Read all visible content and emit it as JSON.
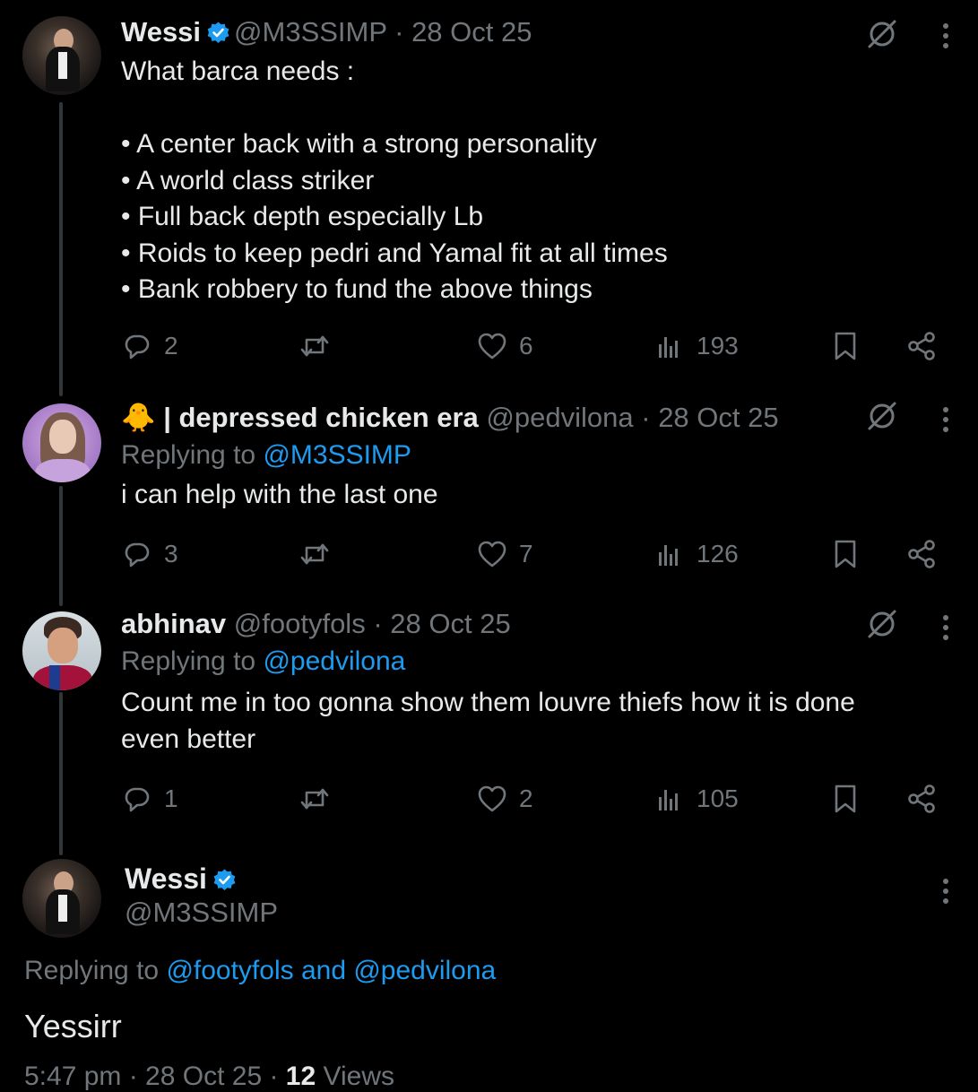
{
  "colors": {
    "background": "#000000",
    "text": "#e7e9ea",
    "muted": "#71767b",
    "link": "#1d9bf0",
    "verified": "#1d9bf0"
  },
  "tweets": [
    {
      "name": "Wessi",
      "handle": "@M3SSIMP",
      "date": "28 Oct 25",
      "text": "What barca needs :\n\n• A center back with a strong personality\n• A world class striker\n• Full back depth especially Lb\n• Roids to keep pedri and Yamal fit at all times\n• Bank robbery to fund the above things",
      "replies": "2",
      "likes": "6",
      "views": "193"
    },
    {
      "name": "🐥 | depressed chicken era",
      "handle": "@pedvilona",
      "date": "28 Oct 25",
      "replying_label": "Replying to",
      "replying_to": "@M3SSIMP",
      "text": "i can help with the last one",
      "replies": "3",
      "likes": "7",
      "views": "126"
    },
    {
      "name": "abhinav",
      "handle": "@footyfols",
      "date": "28 Oct 25",
      "replying_label": "Replying to",
      "replying_to": "@pedvilona",
      "text": "Count me in too gonna show them louvre thiefs how it is done\neven better",
      "replies": "1",
      "likes": "2",
      "views": "105"
    }
  ],
  "main": {
    "name": "Wessi",
    "handle": "@M3SSIMP",
    "replying_label": "Replying to",
    "replying_to": "@footyfols and @pedvilona",
    "text": "Yessirr",
    "time": "5:47 pm · 28 Oct 25 · ",
    "views_count": "12",
    "views_label": " Views"
  },
  "icons": [
    "reply-icon",
    "retweet-icon",
    "like-icon",
    "views-icon",
    "bookmark-icon",
    "share-icon",
    "grok-icon",
    "more-icon",
    "verified-icon"
  ]
}
